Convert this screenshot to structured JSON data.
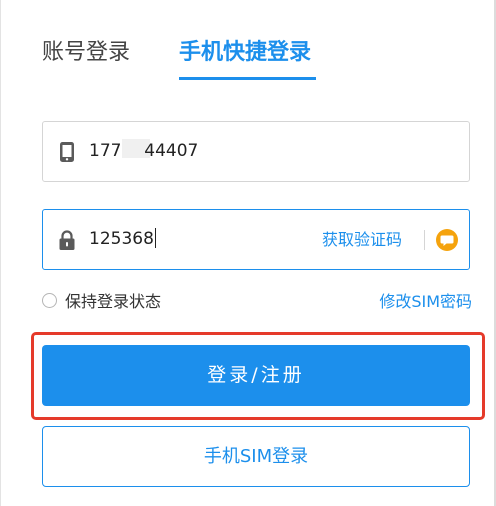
{
  "tabs": {
    "account_label": "账号登录",
    "phone_label": "手机快捷登录",
    "active": "phone"
  },
  "phone_field": {
    "icon": "mobile-phone-icon",
    "value_prefix": "1777",
    "value_suffix": "44407"
  },
  "code_field": {
    "icon": "lock-icon",
    "value": "125368",
    "get_code_label": "获取验证码",
    "extra_icon": "chat-bubble-icon"
  },
  "options": {
    "remember_label": "保持登录状态",
    "remember_checked": false,
    "change_sim_label": "修改SIM密码"
  },
  "buttons": {
    "login_label": "登录/注册",
    "sim_login_label": "手机SIM登录"
  },
  "colors": {
    "accent": "#1c8fec",
    "highlight": "#e53a2a",
    "chat_icon": "#f5a30d"
  }
}
